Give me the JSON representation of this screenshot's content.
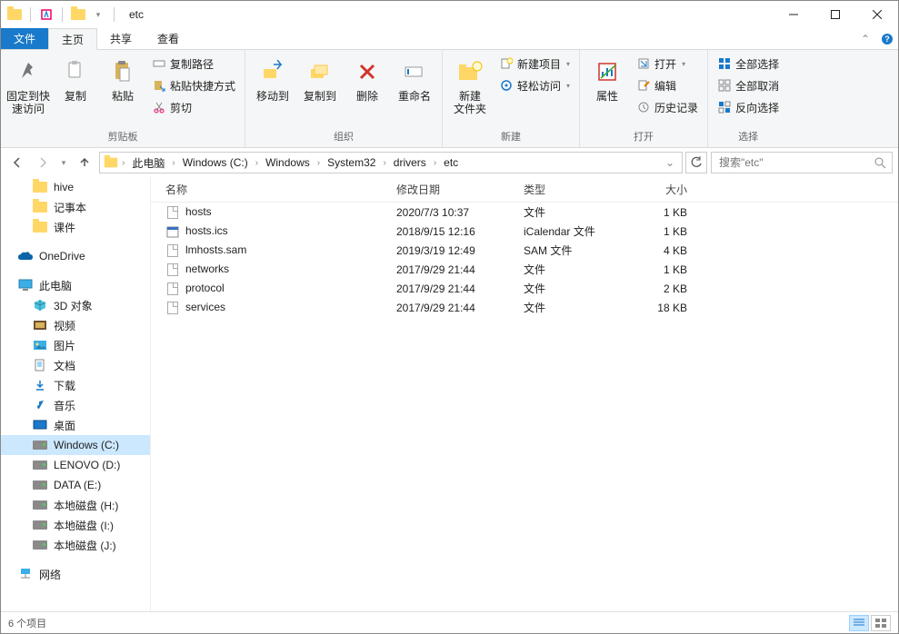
{
  "window": {
    "title": "etc"
  },
  "tabs": {
    "file": "文件",
    "home": "主页",
    "share": "共享",
    "view": "查看"
  },
  "ribbon": {
    "pin": "固定到快\n速访问",
    "copy": "复制",
    "paste": "粘贴",
    "copy_path": "复制路径",
    "paste_shortcut": "粘贴快捷方式",
    "cut": "剪切",
    "group_clipboard": "剪贴板",
    "move_to": "移动到",
    "copy_to": "复制到",
    "delete": "删除",
    "rename": "重命名",
    "group_organize": "组织",
    "new_folder": "新建\n文件夹",
    "new_item": "新建项目",
    "easy_access": "轻松访问",
    "group_new": "新建",
    "properties": "属性",
    "open": "打开",
    "edit": "编辑",
    "history": "历史记录",
    "group_open": "打开",
    "select_all": "全部选择",
    "select_none": "全部取消",
    "invert_sel": "反向选择",
    "group_select": "选择"
  },
  "breadcrumb": {
    "items": [
      "此电脑",
      "Windows (C:)",
      "Windows",
      "System32",
      "drivers",
      "etc"
    ]
  },
  "search": {
    "placeholder": "搜索\"etc\""
  },
  "columns": {
    "name": "名称",
    "date": "修改日期",
    "type": "类型",
    "size": "大小"
  },
  "nav": {
    "hive": "hive",
    "notepad": "记事本",
    "courseware": "课件",
    "onedrive": "OneDrive",
    "this_pc": "此电脑",
    "obj3d": "3D 对象",
    "videos": "视频",
    "pictures": "图片",
    "documents": "文档",
    "downloads": "下载",
    "music": "音乐",
    "desktop": "桌面",
    "drive_c": "Windows (C:)",
    "drive_d": "LENOVO (D:)",
    "drive_e": "DATA (E:)",
    "drive_h": "本地磁盘 (H:)",
    "drive_i": "本地磁盘 (I:)",
    "drive_j": "本地磁盘 (J:)",
    "network": "网络"
  },
  "files": [
    {
      "name": "hosts",
      "date": "2020/7/3 10:37",
      "type": "文件",
      "size": "1 KB",
      "icon": "file"
    },
    {
      "name": "hosts.ics",
      "date": "2018/9/15 12:16",
      "type": "iCalendar 文件",
      "size": "1 KB",
      "icon": "cal"
    },
    {
      "name": "lmhosts.sam",
      "date": "2019/3/19 12:49",
      "type": "SAM 文件",
      "size": "4 KB",
      "icon": "file"
    },
    {
      "name": "networks",
      "date": "2017/9/29 21:44",
      "type": "文件",
      "size": "1 KB",
      "icon": "file"
    },
    {
      "name": "protocol",
      "date": "2017/9/29 21:44",
      "type": "文件",
      "size": "2 KB",
      "icon": "file"
    },
    {
      "name": "services",
      "date": "2017/9/29 21:44",
      "type": "文件",
      "size": "18 KB",
      "icon": "file"
    }
  ],
  "status": {
    "count": "6 个项目"
  }
}
